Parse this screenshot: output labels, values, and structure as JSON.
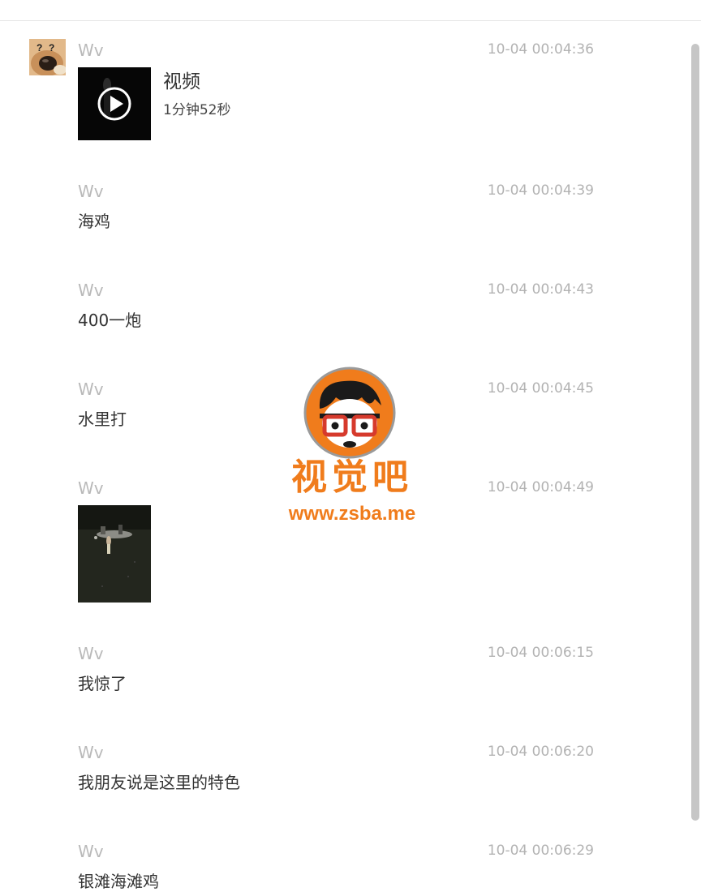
{
  "conversation": {
    "avatar_icon": "dog-avatar-icon",
    "messages": [
      {
        "sender": "Wv",
        "time": "10-04 00:04:36",
        "type": "video",
        "video": {
          "title": "视频",
          "duration": "1分钟52秒",
          "icon": "play-icon"
        }
      },
      {
        "sender": "Wv",
        "time": "10-04 00:04:39",
        "type": "text",
        "text": "海鸡"
      },
      {
        "sender": "Wv",
        "time": "10-04 00:04:43",
        "type": "text",
        "text": "400一炮"
      },
      {
        "sender": "Wv",
        "time": "10-04 00:04:45",
        "type": "text",
        "text": "水里打"
      },
      {
        "sender": "Wv",
        "time": "10-04 00:04:49",
        "type": "image"
      },
      {
        "sender": "Wv",
        "time": "10-04 00:06:15",
        "type": "text",
        "text": "我惊了"
      },
      {
        "sender": "Wv",
        "time": "10-04 00:06:20",
        "type": "text",
        "text": "我朋友说是这里的特色"
      },
      {
        "sender": "Wv",
        "time": "10-04 00:06:29",
        "type": "text",
        "text": "银滩海滩鸡"
      }
    ]
  },
  "watermark": {
    "title": "视觉吧",
    "url": "www.zsba.me",
    "color": "#f07c1c"
  }
}
